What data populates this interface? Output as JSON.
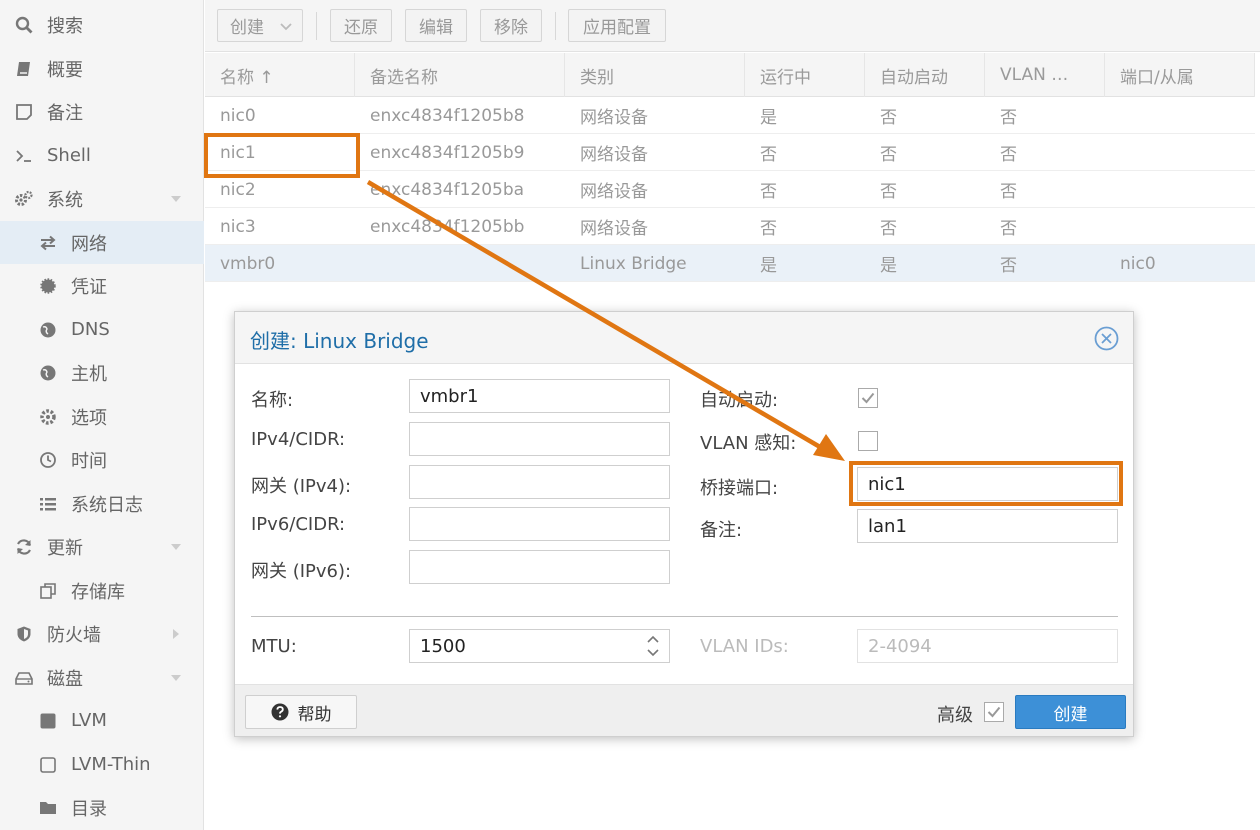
{
  "sidebar": {
    "items": [
      {
        "label": "搜索",
        "icon": "search-icon"
      },
      {
        "label": "概要",
        "icon": "book-icon"
      },
      {
        "label": "备注",
        "icon": "note-icon"
      },
      {
        "label": "Shell",
        "icon": "terminal-icon"
      },
      {
        "label": "系统",
        "icon": "gears-icon"
      },
      {
        "label": "网络",
        "icon": "exchange-icon"
      },
      {
        "label": "凭证",
        "icon": "certificate-icon"
      },
      {
        "label": "DNS",
        "icon": "globe-icon"
      },
      {
        "label": "主机",
        "icon": "globe-icon"
      },
      {
        "label": "选项",
        "icon": "gear-icon"
      },
      {
        "label": "时间",
        "icon": "clock-icon"
      },
      {
        "label": "系统日志",
        "icon": "list-icon"
      },
      {
        "label": "更新",
        "icon": "refresh-icon"
      },
      {
        "label": "存储库",
        "icon": "copy-icon"
      },
      {
        "label": "防火墙",
        "icon": "shield-icon"
      },
      {
        "label": "磁盘",
        "icon": "drive-icon"
      },
      {
        "label": "LVM",
        "icon": "square-icon"
      },
      {
        "label": "LVM-Thin",
        "icon": "square-outline-icon"
      },
      {
        "label": "目录",
        "icon": "folder-icon"
      }
    ]
  },
  "toolbar": {
    "create": "创建",
    "revert": "还原",
    "edit": "编辑",
    "remove": "移除",
    "apply": "应用配置"
  },
  "grid": {
    "columns": [
      "名称 ↑",
      "备选名称",
      "类别",
      "运行中",
      "自动启动",
      "VLAN …",
      "端口/从属"
    ],
    "rows": [
      [
        "nic0",
        "enxc4834f1205b8",
        "网络设备",
        "是",
        "否",
        "否",
        ""
      ],
      [
        "nic1",
        "enxc4834f1205b9",
        "网络设备",
        "否",
        "否",
        "否",
        ""
      ],
      [
        "nic2",
        "enxc4834f1205ba",
        "网络设备",
        "否",
        "否",
        "否",
        ""
      ],
      [
        "nic3",
        "enxc4834f1205bb",
        "网络设备",
        "否",
        "否",
        "否",
        ""
      ],
      [
        "vmbr0",
        "",
        "Linux Bridge",
        "是",
        "是",
        "否",
        "nic0"
      ]
    ]
  },
  "dialog": {
    "title_prefix": "创建: ",
    "title_name": "Linux Bridge",
    "fields": {
      "name_label": "名称:",
      "name_value": "vmbr1",
      "ipv4_label": "IPv4/CIDR:",
      "ipv4_value": "",
      "gw4_label": "网关 (IPv4):",
      "gw4_value": "",
      "ipv6_label": "IPv6/CIDR:",
      "ipv6_value": "",
      "gw6_label": "网关 (IPv6):",
      "gw6_value": "",
      "autostart_label": "自动启动:",
      "autostart_checked": true,
      "vlan_label": "VLAN 感知:",
      "vlan_checked": false,
      "ports_label": "桥接端口:",
      "ports_value": "nic1",
      "comment_label": "备注:",
      "comment_value": "lan1",
      "mtu_label": "MTU:",
      "mtu_value": "1500",
      "vlanids_label": "VLAN IDs:",
      "vlanids_placeholder": "2-4094"
    },
    "footer": {
      "help": "帮助",
      "advanced": "高级",
      "advanced_checked": true,
      "create": "创建"
    }
  },
  "colors": {
    "annotation": "#e07612",
    "accent": "#3d90d7",
    "title": "#1f6ea8"
  }
}
